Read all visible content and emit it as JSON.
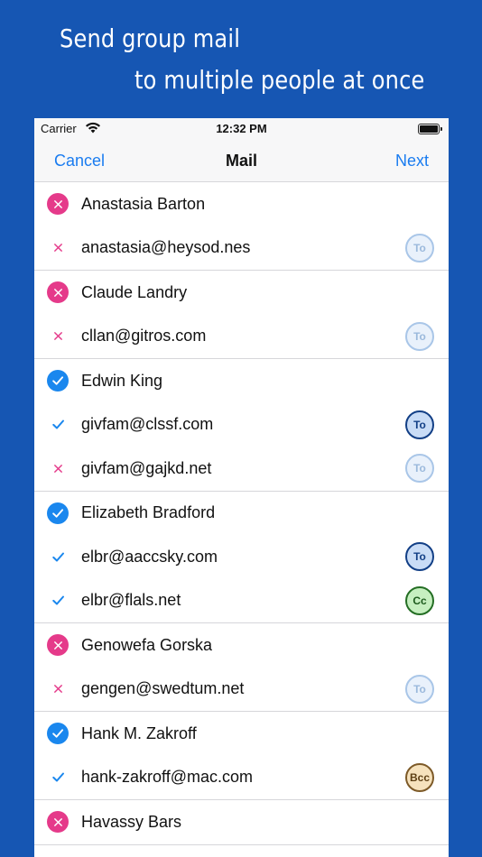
{
  "promo": {
    "line1": "Send group mail",
    "line2": "to multiple people at once"
  },
  "status_bar": {
    "carrier": "Carrier",
    "time": "12:32 PM"
  },
  "nav": {
    "cancel": "Cancel",
    "title": "Mail",
    "next": "Next"
  },
  "contacts": [
    {
      "name": "Anastasia Barton",
      "included": false,
      "emails": [
        {
          "address": "anastasia@heysod.nes",
          "included": false,
          "badge": "To"
        }
      ]
    },
    {
      "name": "Claude Landry",
      "included": false,
      "emails": [
        {
          "address": "cllan@gitros.com",
          "included": false,
          "badge": "To"
        }
      ]
    },
    {
      "name": "Edwin King",
      "included": true,
      "emails": [
        {
          "address": "givfam@clssf.com",
          "included": true,
          "badge": "To"
        },
        {
          "address": "givfam@gajkd.net",
          "included": false,
          "badge": "To"
        }
      ]
    },
    {
      "name": "Elizabeth Bradford",
      "included": true,
      "emails": [
        {
          "address": "elbr@aaccsky.com",
          "included": true,
          "badge": "To"
        },
        {
          "address": "elbr@flals.net",
          "included": true,
          "badge": "Cc"
        }
      ]
    },
    {
      "name": "Genowefa Gorska",
      "included": false,
      "emails": [
        {
          "address": "gengen@swedtum.net",
          "included": false,
          "badge": "To"
        }
      ]
    },
    {
      "name": "Hank M. Zakroff",
      "included": true,
      "emails": [
        {
          "address": "hank-zakroff@mac.com",
          "included": true,
          "badge": "Bcc"
        }
      ]
    },
    {
      "name": "Havassy Bars",
      "included": false,
      "emails": []
    }
  ],
  "colors": {
    "background": "#1656b3",
    "accent": "#1a7cf0",
    "excluded": "#e53a8a",
    "included": "#1a87ee"
  },
  "icons": {
    "excluded": "x-circle-icon",
    "included": "checkmark-circle-icon",
    "wifi": "wifi-icon",
    "battery": "battery-icon"
  }
}
